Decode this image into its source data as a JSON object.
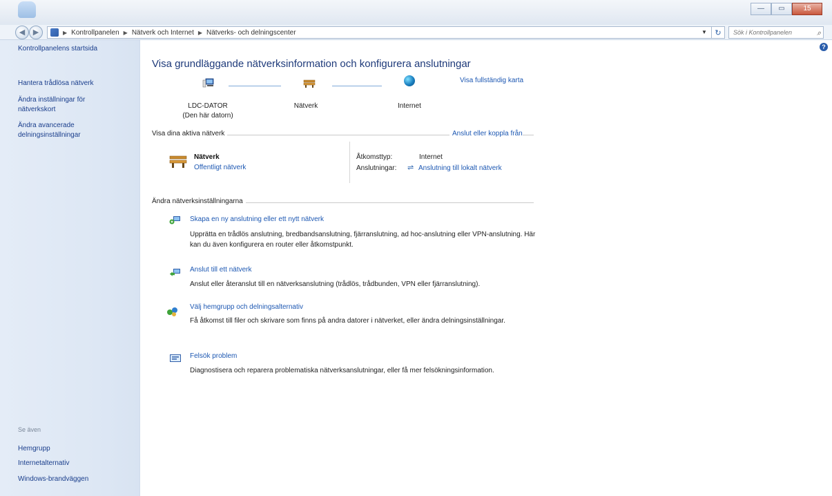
{
  "window": {
    "minimize": "—",
    "maximize": "▭",
    "close": "15"
  },
  "address": {
    "crumbs": [
      "Kontrollpanelen",
      "Nätverk och Internet",
      "Nätverks- och delningscenter"
    ],
    "search_placeholder": "Sök i Kontrollpanelen"
  },
  "sidebar": {
    "home": "Kontrollpanelens startsida",
    "items": [
      "Hantera trådlösa nätverk",
      "Ändra inställningar för nätverkskort",
      "Ändra avancerade delningsinställningar"
    ],
    "see_also_title": "Se även",
    "see_also": [
      "Hemgrupp",
      "Internetalternativ",
      "Windows-brandväggen"
    ]
  },
  "main": {
    "title": "Visa grundläggande nätverksinformation och konfigurera anslutningar",
    "full_map_link": "Visa fullständig karta",
    "map": {
      "computer_name": "LDC-DATOR",
      "computer_sub": "(Den här datorn)",
      "network": "Nätverk",
      "internet": "Internet"
    },
    "active_section": "Visa dina aktiva nätverk",
    "connect_link": "Anslut eller koppla från",
    "active_network": {
      "name": "Nätverk",
      "type": "Offentligt nätverk",
      "access_label": "Åtkomsttyp:",
      "access_value": "Internet",
      "connections_label": "Anslutningar:",
      "connections_value": "Anslutning till lokalt nätverk"
    },
    "change_section": "Ändra nätverksinställningarna",
    "tasks": [
      {
        "title": "Skapa en ny anslutning eller ett nytt nätverk",
        "desc": "Upprätta en trådlös anslutning, bredbandsanslutning, fjärranslutning, ad hoc-anslutning eller VPN-anslutning. Här kan du även konfigurera en router eller åtkomstpunkt."
      },
      {
        "title": "Anslut till ett nätverk",
        "desc": "Anslut eller återanslut till en nätverksanslutning (trådlös, trådbunden, VPN eller fjärranslutning)."
      },
      {
        "title": "Välj hemgrupp och delningsalternativ",
        "desc": "Få åtkomst till filer och skrivare som finns på andra datorer i nätverket, eller ändra delningsinställningar."
      },
      {
        "title": "Felsök problem",
        "desc": "Diagnostisera och reparera problematiska nätverksanslutningar, eller få mer felsökningsinformation."
      }
    ]
  }
}
